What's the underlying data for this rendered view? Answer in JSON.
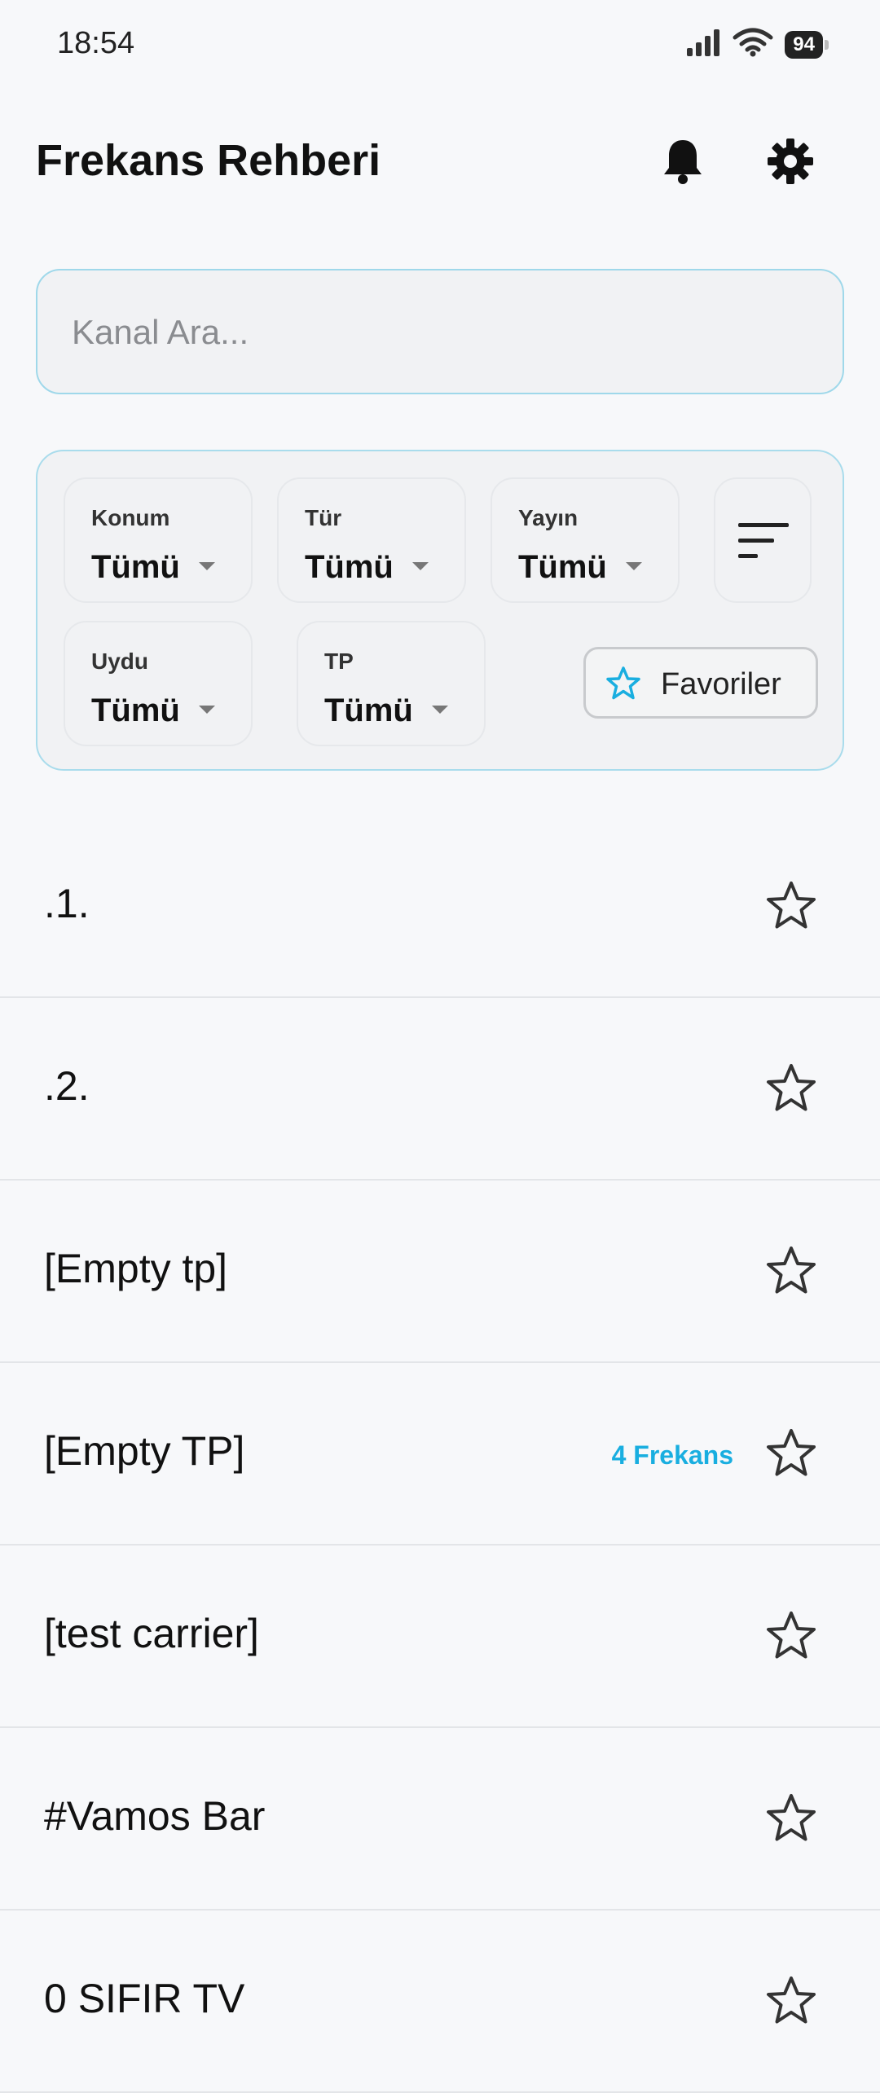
{
  "status_bar": {
    "time": "18:54",
    "battery": "94",
    "icons": [
      "signal-icon",
      "wifi-icon",
      "battery-icon"
    ]
  },
  "header": {
    "title": "Frekans Rehberi",
    "icons": [
      "bell-icon",
      "gear-icon"
    ]
  },
  "search": {
    "placeholder": "Kanal Ara...",
    "value": ""
  },
  "filters": {
    "konum": {
      "label": "Konum",
      "value": "Tümü"
    },
    "tur": {
      "label": "Tür",
      "value": "Tümü"
    },
    "yayin": {
      "label": "Yayın",
      "value": "Tümü"
    },
    "uydu": {
      "label": "Uydu",
      "value": "Tümü"
    },
    "tp": {
      "label": "TP",
      "value": "Tümü"
    },
    "favorites_label": "Favoriler"
  },
  "channels": [
    {
      "name": ".1.",
      "count": ""
    },
    {
      "name": ".2.",
      "count": ""
    },
    {
      "name": "[Empty tp]",
      "count": ""
    },
    {
      "name": "[Empty TP]",
      "count": "4 Frekans"
    },
    {
      "name": "[test carrier]",
      "count": ""
    },
    {
      "name": "#Vamos Bar",
      "count": ""
    },
    {
      "name": "0 SIFIR TV",
      "count": ""
    }
  ],
  "colors": {
    "accent": "#19aee0",
    "panel_border": "#a9dcec",
    "background": "#f7f8fa"
  }
}
